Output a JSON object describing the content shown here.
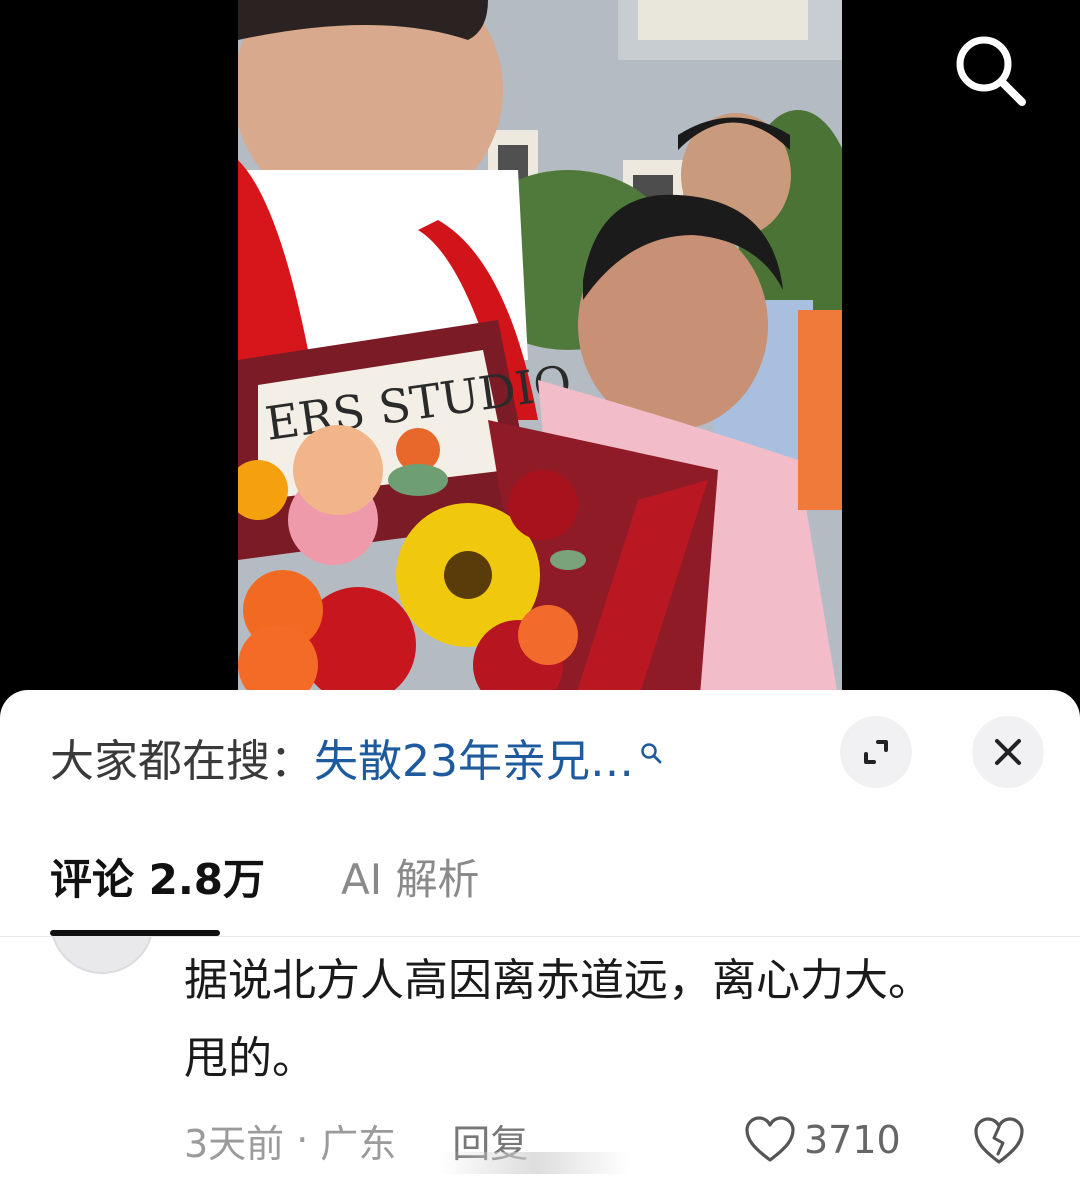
{
  "video": {
    "studio_sign": "ERS STUDIO"
  },
  "top_bar": {
    "search_icon": "search-icon"
  },
  "hot_search": {
    "prefix": "大家都在搜：",
    "query": "失散23年亲兄…",
    "query_icon": "search-icon",
    "expand_icon": "expand-icon",
    "close_icon": "close-icon"
  },
  "tabs": [
    {
      "label": "评论 2.8万",
      "active": true
    },
    {
      "label": "AI 解析",
      "active": false
    }
  ],
  "comment": {
    "text": "据说北方人高因离赤道远，离心力大。甩的。",
    "time": "3天前",
    "separator": "·",
    "location": "广东",
    "reply_label": "回复",
    "like_count": "3710",
    "like_icon": "heart-icon",
    "dislike_icon": "broken-heart-icon"
  },
  "colors": {
    "video_background": "#000000",
    "query_blue": "#1d5a9e",
    "active_tab": "#111111",
    "inactive_tab": "#8a8a8a",
    "meta_gray": "#9b9b9b",
    "button_gray": "#f1f1f3"
  }
}
